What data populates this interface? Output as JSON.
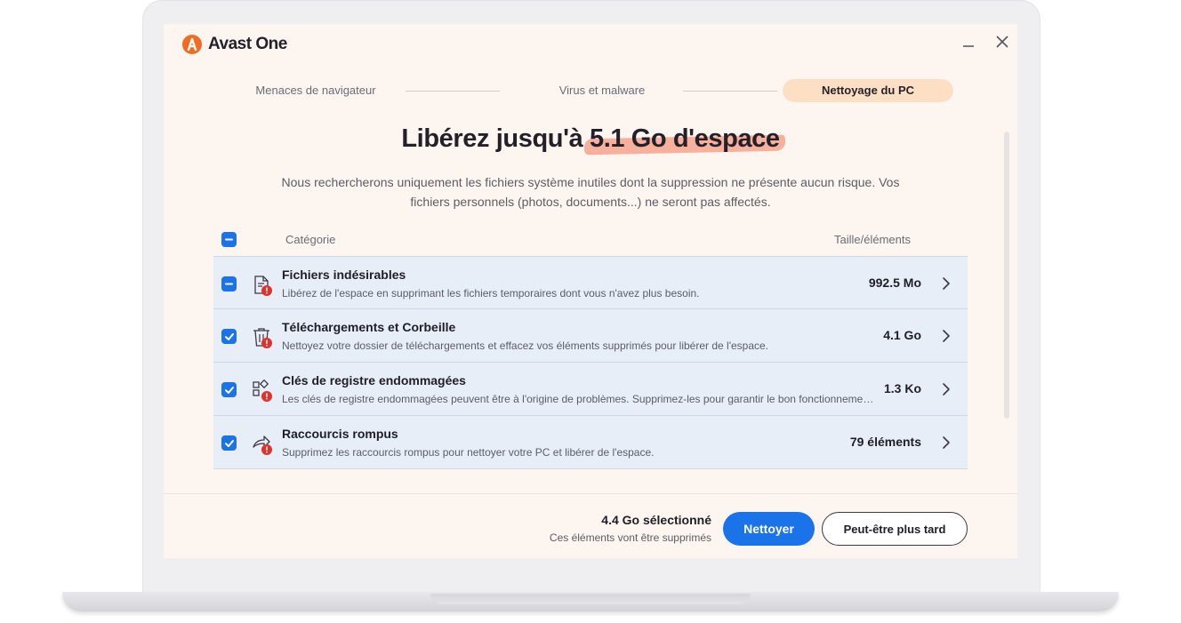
{
  "app": {
    "name": "Avast One",
    "brand_color": "#f26b21",
    "accent_color": "#1a73e8"
  },
  "stepper": {
    "steps": [
      {
        "label": "Menaces de navigateur",
        "state": "done"
      },
      {
        "label": "Virus et malware",
        "state": "done"
      },
      {
        "label": "Nettoyage du PC",
        "state": "active"
      }
    ]
  },
  "headline": {
    "prefix": "Libérez jusqu'à ",
    "highlight": "5.1 Go d'espace"
  },
  "subtitle": {
    "line1": "Nous rechercherons uniquement les fichiers système inutiles dont la suppression ne présente aucun risque. Vos",
    "line2": "fichiers personnels (photos, documents...) ne seront pas affectés."
  },
  "table": {
    "header_category": "Catégorie",
    "header_size": "Taille/éléments",
    "select_all_state": "indeterminate",
    "rows": [
      {
        "title": "Fichiers indésirables",
        "description": "Libérez de l'espace en supprimant les fichiers temporaires dont vous n'avez plus besoin.",
        "size": "992.5 Mo",
        "check_state": "indeterminate",
        "icon": "junk-file-icon"
      },
      {
        "title": "Téléchargements et Corbeille",
        "description": "Nettoyez votre dossier de téléchargements et effacez vos éléments supprimés pour libérer de l'espace.",
        "size": "4.1 Go",
        "check_state": "checked",
        "icon": "trash-icon"
      },
      {
        "title": "Clés de registre endommagées",
        "description": "Les clés de registre endommagées peuvent être à l'origine de problèmes. Supprimez-les pour garantir le bon fonctionnement de votre PC.",
        "size": "1.3 Ko",
        "check_state": "checked",
        "icon": "registry-icon"
      },
      {
        "title": "Raccourcis rompus",
        "description": "Supprimez les raccourcis rompus pour nettoyer votre PC et libérer de l'espace.",
        "size": "79 éléments",
        "check_state": "checked",
        "icon": "broken-shortcut-icon"
      }
    ]
  },
  "footer": {
    "selected_total": "4.4 Go sélectionné",
    "note": "Ces éléments vont être supprimés",
    "primary_button": "Nettoyer",
    "secondary_button": "Peut-être plus tard"
  }
}
